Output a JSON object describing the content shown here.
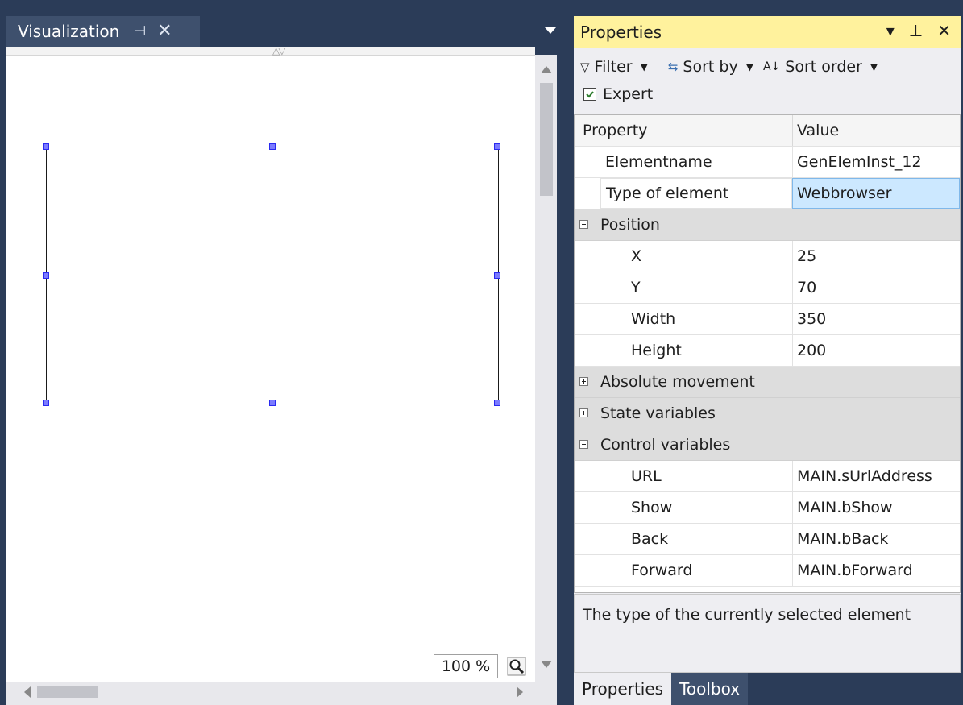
{
  "visualization": {
    "tab_title": "Visualization",
    "pin_icon": "⊣",
    "close_icon": "✕",
    "zoom_level": "100 %"
  },
  "properties": {
    "title": "Properties",
    "toolbar": {
      "filter_label": "Filter",
      "sort_by_label": "Sort by",
      "sort_order_label": "Sort order"
    },
    "expert_label": "Expert",
    "expert_checked": true,
    "grid": {
      "header": {
        "property": "Property",
        "value": "Value"
      },
      "rows": [
        {
          "name": "Elementname",
          "value": "GenElemInst_12"
        },
        {
          "name": "Type of element",
          "value": "Webbrowser"
        },
        {
          "name": "Position",
          "category": true,
          "expanded": true
        },
        {
          "name": "X",
          "value": "25"
        },
        {
          "name": "Y",
          "value": "70"
        },
        {
          "name": "Width",
          "value": "350"
        },
        {
          "name": "Height",
          "value": "200"
        },
        {
          "name": "Absolute movement",
          "category": true,
          "expanded": false
        },
        {
          "name": "State variables",
          "category": true,
          "expanded": false
        },
        {
          "name": "Control variables",
          "category": true,
          "expanded": true
        },
        {
          "name": "URL",
          "value": "MAIN.sUrlAddress"
        },
        {
          "name": "Show",
          "value": "MAIN.bShow"
        },
        {
          "name": "Back",
          "value": "MAIN.bBack"
        },
        {
          "name": "Forward",
          "value": "MAIN.bForward"
        }
      ]
    },
    "description": "The type of the currently selected element",
    "tabs": [
      {
        "label": "Properties",
        "active": true
      },
      {
        "label": "Toolbox",
        "active": false
      }
    ]
  },
  "colors": {
    "frame": "#2b3c58",
    "title_highlight": "#fff29d",
    "selection": "#cce8ff",
    "handle": "#7b7bff"
  }
}
